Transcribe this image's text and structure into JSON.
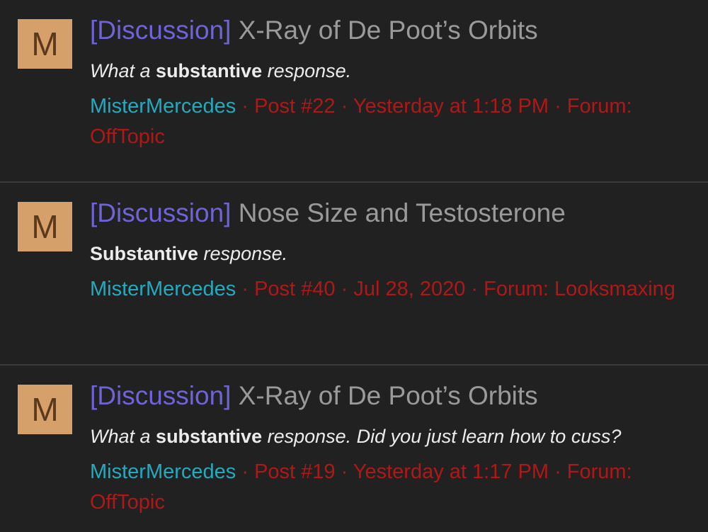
{
  "results": [
    {
      "avatar_letter": "M",
      "prefix": "[Discussion]",
      "thread_title": "X-Ray of De Poot’s Orbits",
      "snippet": {
        "before": "What a ",
        "bold": "substantive",
        "after": " response."
      },
      "author": "MisterMercedes",
      "post": "Post #22",
      "date": "Yesterday at 1:18 PM",
      "forum_label": "Forum:",
      "forum": "OffTopic"
    },
    {
      "avatar_letter": "M",
      "prefix": "[Discussion]",
      "thread_title": "Nose Size and Testosterone",
      "snippet": {
        "before": "",
        "bold": "Substantive",
        "after": " response."
      },
      "author": "MisterMercedes",
      "post": "Post #40",
      "date": "Jul 28, 2020",
      "forum_label": "Forum:",
      "forum": "Looksmaxing"
    },
    {
      "avatar_letter": "M",
      "prefix": "[Discussion]",
      "thread_title": "X-Ray of De Poot’s Orbits",
      "snippet": {
        "before": "What a ",
        "bold": "substantive",
        "after": " response. Did you just learn how to cuss?"
      },
      "author": "MisterMercedes",
      "post": "Post #19",
      "date": "Yesterday at 1:17 PM",
      "forum_label": "Forum:",
      "forum": "OffTopic"
    }
  ],
  "separator": " · ",
  "colors": {
    "background": "#212121",
    "prefix": "#6f63d9",
    "title": "#9a9a9a",
    "author": "#22aabf",
    "meta": "#b01818",
    "avatar_bg": "#d6a06a"
  }
}
